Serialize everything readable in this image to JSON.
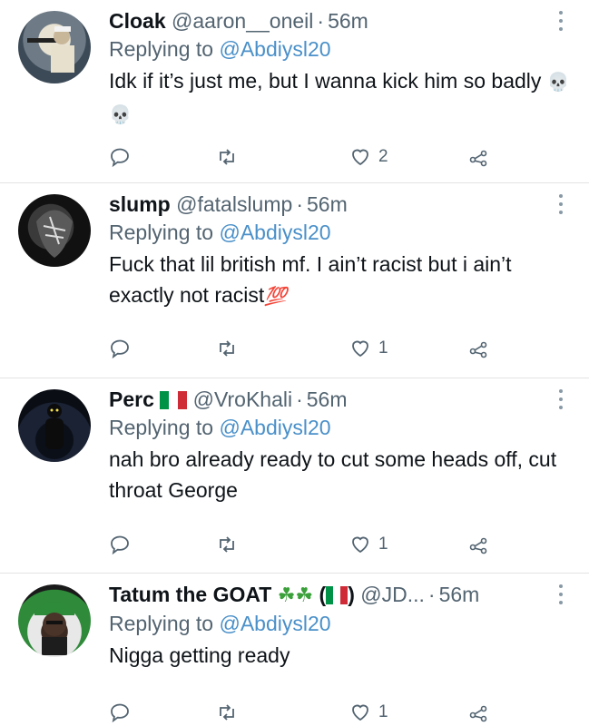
{
  "tweets": [
    {
      "name": "Cloak",
      "handle": "@aaron__oneil",
      "time": "56m",
      "reply_label": "Replying to",
      "reply_to": "@Abdiysl20",
      "text": "Idk if it’s just me, but I wanna kick him so badly",
      "emoji": "💀💀",
      "likes": "2",
      "avatar_icon": "profile-photo-gunman"
    },
    {
      "name": "slump",
      "handle": "@fatalslump",
      "time": "56m",
      "reply_label": "Replying to",
      "reply_to": "@Abdiysl20",
      "text": "Fuck that lil british mf. I ain’t racist but i ain’t exactly not racist",
      "emoji": "💯",
      "likes": "1",
      "avatar_icon": "profile-photo-sketch"
    },
    {
      "name": "Perc",
      "handle": "@VroKhali",
      "time": "56m",
      "reply_label": "Replying to",
      "reply_to": "@Abdiysl20",
      "text": "nah bro already ready to cut some heads off, cut throat George",
      "likes": "1",
      "avatar_icon": "profile-photo-dark-figure"
    },
    {
      "name": "Tatum the GOAT",
      "name_suffix": "(",
      "name_suffix_end": ")",
      "handle": "@JD...",
      "time": "56m",
      "reply_label": "Replying to",
      "reply_to": "@Abdiysl20",
      "text": "Nigga getting ready",
      "likes": "1",
      "clovers": "☘☘",
      "avatar_icon": "profile-photo-green-cap"
    }
  ],
  "colors": {
    "mention": "#4a90c9",
    "secondary_text": "#536471",
    "primary_text": "#0f1419"
  },
  "icons": {
    "reply": "reply-icon",
    "retweet": "retweet-icon",
    "like": "heart-icon",
    "share": "share-icon",
    "more": "more-icon"
  }
}
